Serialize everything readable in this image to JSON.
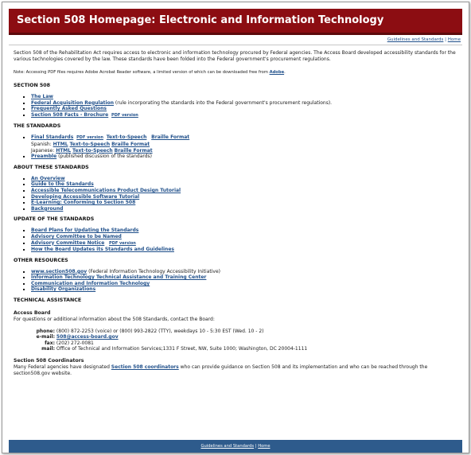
{
  "banner": {
    "title": "Section 508 Homepage:  Electronic and Information Technology"
  },
  "topnav": {
    "link1": "Guidelines and Standards",
    "separator": "|",
    "link2": "Home"
  },
  "intro": "Section 508 of the Rehabilitation Act requires access to electronic and information technology procured by Federal agencies. The Access Board developed accessibility standards for the various technologies covered by the law. These standards have been folded into the Federal government's procurement regulations.",
  "note": {
    "text": "Note: Accessing PDF files requires Adobe Acrobat Reader software, a limited version of which can be downloaded free from ",
    "link": "Adobe",
    "end": "."
  },
  "section508": {
    "heading": "SECTION 508",
    "items": [
      {
        "link": "The Law",
        "text": ""
      },
      {
        "link": "Federal Acquisition Regulation",
        "text": " (rule incorporating the standards into the Federal government's procurement regulations)."
      },
      {
        "link": "Frequently Asked Questions",
        "text": ""
      },
      {
        "link": "Section 508 Facts - Brochure",
        "text": "",
        "pdf": "PDF version"
      }
    ]
  },
  "standards": {
    "heading": "THE STANDARDS",
    "final": "Final Standards",
    "pdf": "PDF version",
    "tts": "Text-to-Speech",
    "braille": "Braille Format",
    "spanish_label": "Spanish:",
    "japanese_label": "Japanese:",
    "html": "HTML",
    "preamble": "Preamble",
    "preamble_text": " (published discussion of the standards)"
  },
  "about": {
    "heading": "ABOUT THESE STANDARDS",
    "items": [
      "An Overview",
      "Guide to the Standards",
      "Accessible Telecommunications Product Design Tutorial",
      "Developing Accessible Software Tutorial",
      "E-Learning: Conforming to Section 508",
      "Background"
    ]
  },
  "update": {
    "heading": "UPDATE OF THE STANDARDS",
    "items": [
      {
        "link": "Board Plans for Updating the Standards"
      },
      {
        "link": "Advisory Committee to be Named"
      },
      {
        "link": "Advisory Committee Notice",
        "pdf": "PDF version"
      },
      {
        "link": "How the Board Updates its Standards and Guidelines"
      }
    ]
  },
  "other": {
    "heading": "OTHER RESOURCES",
    "items": [
      {
        "link": "www.section508.gov",
        "text": " (Federal Information Technology Accessibility Initiative)"
      },
      {
        "link": "Information Technology Technical Assistance and Training Center",
        "text": ""
      },
      {
        "link": "Communication and Information Technology",
        "text": ""
      },
      {
        "link": "Disability Organizations",
        "text": ""
      }
    ]
  },
  "tech": {
    "heading": "TECHNICAL ASSISTANCE",
    "board_heading": "Access Board",
    "board_text": "For questions or additional information about the 508 Standards, contact the Board:",
    "phone_label": "phone:",
    "phone": "(800) 872-2253 (voice) or (800) 993-2822 (TTY), weekdays 10 - 5:30 EST (Wed. 10 - 2)",
    "email_label": "e-mail:",
    "email": "508@access-board.gov",
    "fax_label": "fax:",
    "fax": "(202) 272-0081",
    "mail_label": "mail:",
    "mail": "Office of Technical and Information Services;1331 F Street, NW, Suite 1000; Washington, DC 20004-1111",
    "coord_heading": "Section 508 Coordinators",
    "coord_text1": "Many Federal agencies have designated ",
    "coord_link": "Section 508 coordinators",
    "coord_text2": " who can provide guidance on Section 508 and its implementation and who can be reached through the section508.gov website."
  },
  "bottomnav": {
    "link1": "Guidelines and Standards",
    "separator": "|",
    "link2": "Home"
  }
}
